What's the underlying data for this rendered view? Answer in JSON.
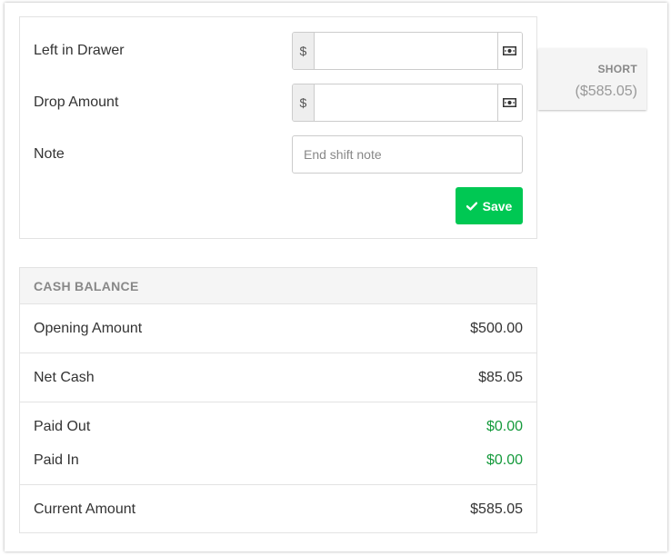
{
  "form": {
    "left_in_drawer": {
      "label": "Left in Drawer",
      "prefix": "$",
      "value": "",
      "icon": "money-bill-icon"
    },
    "drop_amount": {
      "label": "Drop Amount",
      "prefix": "$",
      "value": "",
      "icon": "money-bill-icon"
    },
    "note": {
      "label": "Note",
      "placeholder": "End shift note",
      "value": ""
    },
    "save_label": "Save",
    "save_icon": "check-icon"
  },
  "short_card": {
    "label": "SHORT",
    "value": "($585.05)"
  },
  "cash_balance": {
    "title": "CASH BALANCE",
    "opening_amount": {
      "label": "Opening Amount",
      "value": "$500.00"
    },
    "net_cash": {
      "label": "Net Cash",
      "value": "$85.05"
    },
    "paid_out": {
      "label": "Paid Out",
      "value": "$0.00"
    },
    "paid_in": {
      "label": "Paid In",
      "value": "$0.00"
    },
    "current_amount": {
      "label": "Current Amount",
      "value": "$585.05"
    }
  },
  "colors": {
    "accent": "#00c853",
    "positive_text": "#159a3c",
    "muted_text": "#888888"
  }
}
